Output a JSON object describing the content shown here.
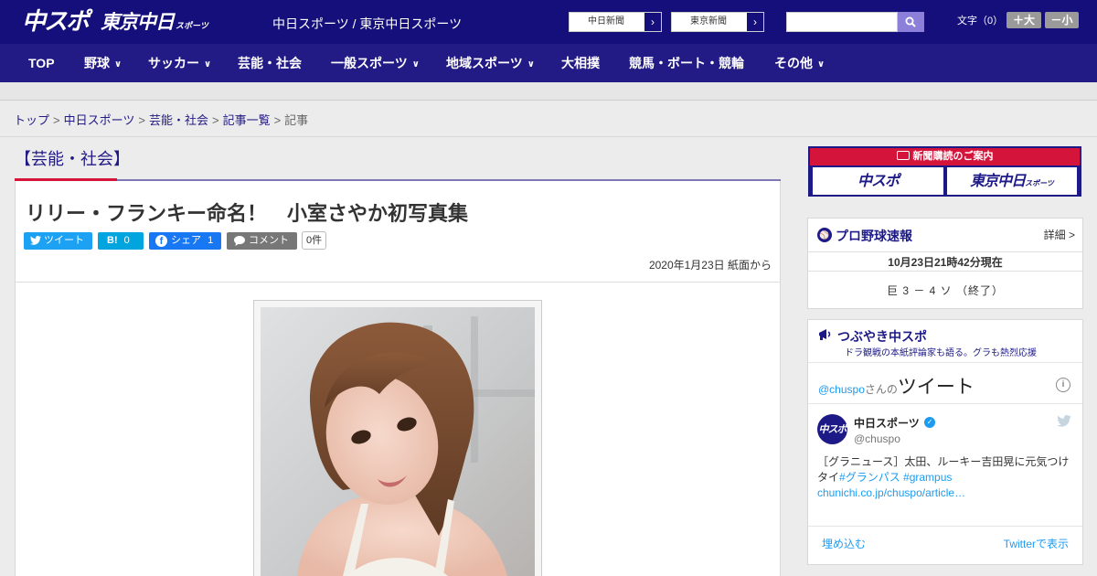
{
  "header": {
    "logo_main": "中スポ",
    "logo_tokyo": "東京中日",
    "logo_tokyo_small": "スポーツ",
    "site_name": "中日スポーツ / 東京中日スポーツ",
    "ext_links": [
      "中日新聞",
      "東京新聞"
    ],
    "search_placeholder": "",
    "font_size_label": "文字（0）",
    "font_plus": "＋大",
    "font_minus": "－小"
  },
  "nav": [
    {
      "label": "TOP",
      "dropdown": false
    },
    {
      "label": "野球",
      "dropdown": true
    },
    {
      "label": "サッカー",
      "dropdown": true
    },
    {
      "label": "芸能・社会",
      "dropdown": false
    },
    {
      "label": "一般スポーツ",
      "dropdown": true
    },
    {
      "label": "地域スポーツ",
      "dropdown": true
    },
    {
      "label": "大相撲",
      "dropdown": false
    },
    {
      "label": "競馬・ボート・競輪",
      "dropdown": false
    },
    {
      "label": "その他",
      "dropdown": true
    }
  ],
  "breadcrumb": [
    "トップ",
    "中日スポーツ",
    "芸能・社会",
    "記事一覧",
    "記事"
  ],
  "article": {
    "category": "【芸能・社会】",
    "title": "リリー・フランキー命名！　小室さやか初写真集",
    "share": {
      "tweet": "ツイート",
      "hatena": "B!",
      "hatena_count": "0",
      "facebook": "シェア",
      "facebook_count": "1",
      "comment": "コメント",
      "comment_count": "0件"
    },
    "date": "2020年1月23日 紙面から"
  },
  "sidebar": {
    "promo_top": "新聞購読のご案内",
    "promo_a": "中スポ",
    "promo_b": "東京中日",
    "promo_b_small": "スポーツ",
    "baseball": {
      "title": "プロ野球速報",
      "detail": "詳細 >",
      "time": "10月23日21時42分現在",
      "score": "巨 3 － 4 ソ （終了）"
    },
    "tweets": {
      "title": "つぶやき中スポ",
      "subtitle": "ドラ観戦の本紙評論家も語る。グラも熱烈応援",
      "by_handle": "@chuspo",
      "by_suffix": "さんの",
      "by_big": "ツイート",
      "info": "i",
      "avatar": "中スポ",
      "name": "中日スポーツ",
      "handle": "@chuspo",
      "text_plain": "［グラニュース］太田、ルーキー吉田晃に元気つけタイ",
      "tags": "#グランパス #grampus",
      "link": "chunichi.co.jp/chuspo/article…",
      "embed": "埋め込む",
      "view_on_twitter": "Twitterで表示"
    }
  },
  "colors": {
    "header_bg": "#140f7a",
    "nav_bg": "#221a85",
    "accent_red": "#d4143a",
    "twitter": "#1da1f2",
    "facebook": "#1877f2",
    "hatena": "#00a4de"
  }
}
